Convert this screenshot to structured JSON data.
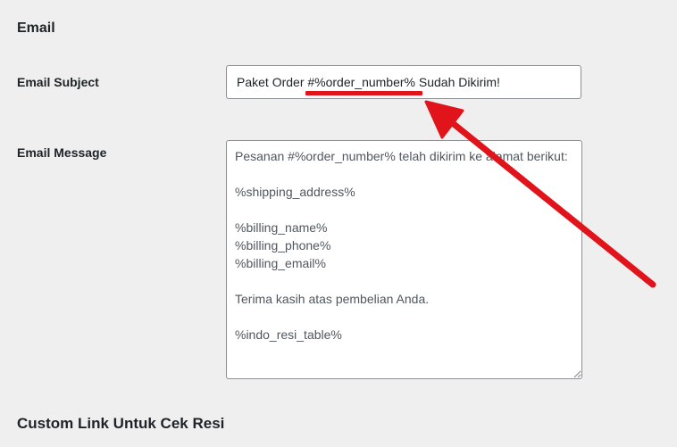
{
  "section": {
    "title": "Email"
  },
  "fields": {
    "subject": {
      "label": "Email Subject",
      "value": "Paket Order #%order_number% Sudah Dikirim!"
    },
    "message": {
      "label": "Email Message",
      "value": "Pesanan #%order_number% telah dikirim ke alamat berikut:\n\n%shipping_address%\n\n%billing_name%\n%billing_phone%\n%billing_email%\n\nTerima kasih atas pembelian Anda.\n\n%indo_resi_table%"
    }
  },
  "next_section": {
    "title": "Custom Link Untuk Cek Resi"
  },
  "annotation": {
    "color": "#e0141a",
    "icon": "red-arrow-icon"
  }
}
